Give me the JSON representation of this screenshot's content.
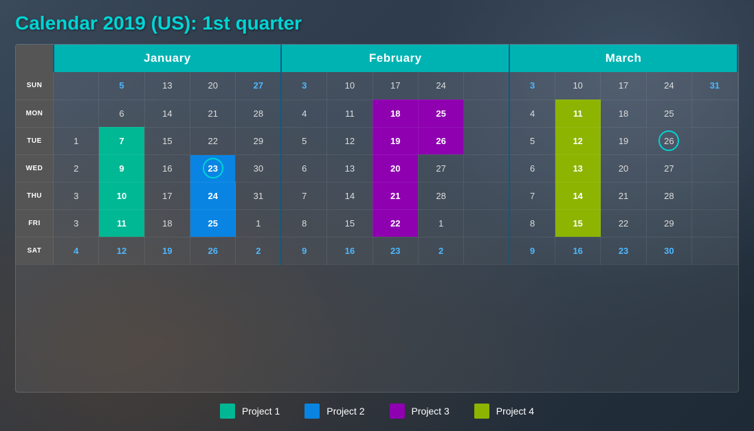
{
  "title": "Calendar 2019 (US): 1st quarter",
  "months": [
    {
      "name": "January",
      "span": 5
    },
    {
      "name": "February",
      "span": 5
    },
    {
      "name": "March",
      "span": 5
    }
  ],
  "days_of_week": [
    "SUN",
    "MON",
    "TUE",
    "WED",
    "THU",
    "FRI",
    "SAT"
  ],
  "rows": [
    {
      "label": "SUN",
      "jan": [
        "",
        "5",
        "13",
        "20",
        "27"
      ],
      "feb": [
        "3",
        "10",
        "17",
        "24",
        ""
      ],
      "mar": [
        "3",
        "10",
        "17",
        "24",
        "31"
      ],
      "jan_class": [
        "",
        "weekend",
        "",
        "",
        "weekend"
      ],
      "feb_class": [
        "weekend",
        "",
        "",
        "",
        ""
      ],
      "mar_class": [
        "weekend",
        "",
        "",
        "",
        "weekend"
      ]
    },
    {
      "label": "MON",
      "jan": [
        "",
        "6",
        "14",
        "21",
        "28"
      ],
      "feb": [
        "4",
        "11",
        "18",
        "25",
        ""
      ],
      "mar": [
        "4",
        "11",
        "18",
        "25",
        ""
      ],
      "jan_class": [
        "",
        "",
        "",
        "",
        ""
      ],
      "feb_class": [
        "",
        "",
        "proj3",
        "proj3",
        ""
      ],
      "mar_class": [
        "",
        "proj4",
        "",
        "",
        ""
      ]
    },
    {
      "label": "TUE",
      "jan": [
        "1",
        "7",
        "15",
        "22",
        "29"
      ],
      "feb": [
        "5",
        "12",
        "19",
        "26",
        ""
      ],
      "mar": [
        "5",
        "12",
        "19",
        "26",
        ""
      ],
      "jan_class": [
        "",
        "proj1",
        "",
        "",
        ""
      ],
      "feb_class": [
        "",
        "",
        "proj3",
        "proj3",
        ""
      ],
      "mar_class": [
        "",
        "proj4",
        "",
        "circled",
        ""
      ]
    },
    {
      "label": "WED",
      "jan": [
        "2",
        "9",
        "16",
        "23",
        "30"
      ],
      "feb": [
        "6",
        "13",
        "20",
        "27",
        ""
      ],
      "mar": [
        "6",
        "13",
        "20",
        "27",
        ""
      ],
      "jan_class": [
        "",
        "proj1",
        "",
        "proj2-circled",
        ""
      ],
      "feb_class": [
        "",
        "",
        "proj3",
        "",
        ""
      ],
      "mar_class": [
        "",
        "proj4",
        "",
        "",
        ""
      ]
    },
    {
      "label": "THU",
      "jan": [
        "3",
        "10",
        "17",
        "24",
        "31"
      ],
      "feb": [
        "7",
        "14",
        "21",
        "28",
        ""
      ],
      "mar": [
        "7",
        "14",
        "21",
        "28",
        ""
      ],
      "jan_class": [
        "",
        "proj1",
        "",
        "proj2",
        ""
      ],
      "feb_class": [
        "",
        "",
        "proj3",
        "",
        ""
      ],
      "mar_class": [
        "",
        "proj4",
        "",
        "",
        ""
      ]
    },
    {
      "label": "FRI",
      "jan": [
        "3",
        "11",
        "18",
        "25",
        "1"
      ],
      "feb": [
        "8",
        "15",
        "22",
        "1",
        ""
      ],
      "mar": [
        "8",
        "15",
        "22",
        "29",
        ""
      ],
      "jan_class": [
        "",
        "proj1",
        "",
        "proj2",
        ""
      ],
      "feb_class": [
        "",
        "",
        "proj3",
        "",
        ""
      ],
      "mar_class": [
        "",
        "proj4",
        "",
        "",
        ""
      ]
    },
    {
      "label": "SAT",
      "jan": [
        "4",
        "12",
        "19",
        "26",
        "2"
      ],
      "feb": [
        "9",
        "16",
        "23",
        "2",
        ""
      ],
      "mar": [
        "9",
        "16",
        "23",
        "30",
        ""
      ],
      "jan_class": [
        "weekend",
        "weekend",
        "weekend",
        "weekend",
        "weekend"
      ],
      "feb_class": [
        "weekend",
        "weekend",
        "weekend",
        "weekend",
        ""
      ],
      "mar_class": [
        "weekend",
        "weekend",
        "weekend",
        "weekend",
        ""
      ]
    }
  ],
  "legend": [
    {
      "label": "Project 1",
      "class": "proj1"
    },
    {
      "label": "Project 2",
      "class": "proj2"
    },
    {
      "label": "Project 3",
      "class": "proj3"
    },
    {
      "label": "Project 4",
      "class": "proj4"
    }
  ]
}
